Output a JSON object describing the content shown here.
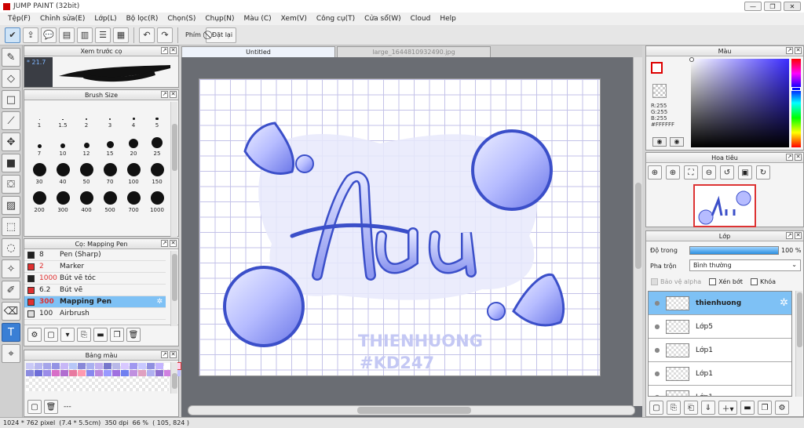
{
  "app": {
    "title": "JUMP PAINT (32bit)"
  },
  "window_controls": {
    "minimize": "—",
    "restore": "❐",
    "close": "✕"
  },
  "menu": [
    "Tệp(F)",
    "Chỉnh sửa(E)",
    "Lớp(L)",
    "Bộ lọc(R)",
    "Chọn(S)",
    "Chụp(N)",
    "Màu (C)",
    "Xem(V)",
    "Công cụ(T)",
    "Cửa sổ(W)",
    "Cloud",
    "Help"
  ],
  "toolbar": {
    "keys_label": "Phím",
    "reset_label": "Đặt lại"
  },
  "brush_preview": {
    "title": "Xem trước cọ",
    "size_text": "* 21.7"
  },
  "brush_size": {
    "title": "Brush Size",
    "sizes": [
      "1",
      "1.5",
      "2",
      "3",
      "4",
      "5",
      "7",
      "10",
      "12",
      "15",
      "20",
      "25",
      "30",
      "40",
      "50",
      "70",
      "100",
      "150",
      "200",
      "300",
      "400",
      "500",
      "700",
      "1000"
    ]
  },
  "pen_panel": {
    "title": "Cọ: Mapping Pen",
    "items": [
      {
        "size": "8",
        "name": "Pen (Sharp)",
        "color": "#222222",
        "size_color": "#222222"
      },
      {
        "size": "2",
        "name": "Marker",
        "color": "#e03030",
        "size_color": "#e03030"
      },
      {
        "size": "1000",
        "name": "Bút vẽ tóc",
        "color": "#222222",
        "size_color": "#e03030"
      },
      {
        "size": "6.2",
        "name": "Bút vẽ",
        "color": "#e03030",
        "size_color": "#222222"
      },
      {
        "size": "300",
        "name": "Mapping Pen",
        "color": "#e03030",
        "size_color": "#e03030"
      },
      {
        "size": "100",
        "name": "Airbrush",
        "color": "#dddddd",
        "size_color": "#222222"
      }
    ]
  },
  "palette_panel": {
    "title": "Bảng màu",
    "footer": "---"
  },
  "tabs": {
    "active": "Untitled",
    "inactive": "large_1644810932490.jpg"
  },
  "artwork": {
    "text1": "THIENHUONG",
    "text2": "#KD247"
  },
  "color_panel": {
    "title": "Màu",
    "r": "R:255",
    "g": "G:255",
    "b": "B:255",
    "hex": "#FFFFFF"
  },
  "navigator": {
    "title": "Hoa tiêu"
  },
  "layers": {
    "title": "Lớp",
    "opacity_label": "Độ trong",
    "opacity_value": "100 %",
    "opacity": 1.0,
    "blend_label": "Pha trộn",
    "blend_value": "Bình thường",
    "protect_alpha": "Bảo vệ alpha",
    "clip": "Xén bớt",
    "lock": "Khóa",
    "items": [
      "thienhuong",
      "Lớp5",
      "Lớp1",
      "Lớp1",
      "Lớp1"
    ]
  },
  "status": {
    "dims": "1024 * 762 pixel",
    "cm": "(7.4 * 5.5cm)",
    "dpi": "350 dpi",
    "zoom": "66 %",
    "coords": "( 105, 824 )"
  },
  "colors": {
    "accent": "#7ec1f5",
    "art_blue": "#3b4fc9",
    "art_light": "#c9ccff",
    "canvas_bg": "#6a6d73"
  }
}
